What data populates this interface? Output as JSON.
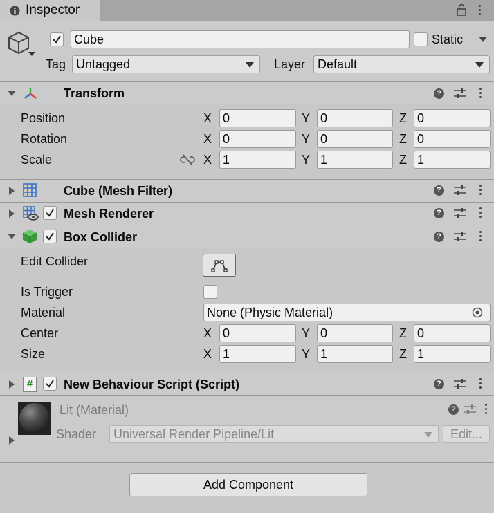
{
  "tab": {
    "title": "Inspector"
  },
  "object": {
    "active": true,
    "name": "Cube",
    "static_label": "Static",
    "tag_label": "Tag",
    "tag_value": "Untagged",
    "layer_label": "Layer",
    "layer_value": "Default"
  },
  "transform": {
    "title": "Transform",
    "rows": [
      {
        "label": "Position",
        "x": "0",
        "y": "0",
        "z": "0"
      },
      {
        "label": "Rotation",
        "x": "0",
        "y": "0",
        "z": "0"
      },
      {
        "label": "Scale",
        "x": "1",
        "y": "1",
        "z": "1"
      }
    ]
  },
  "axes": {
    "x": "X",
    "y": "Y",
    "z": "Z"
  },
  "mesh_filter": {
    "title": "Cube (Mesh Filter)"
  },
  "mesh_renderer": {
    "title": "Mesh Renderer",
    "enabled": true
  },
  "box_collider": {
    "title": "Box Collider",
    "enabled": true,
    "edit_collider_label": "Edit Collider",
    "is_trigger_label": "Is Trigger",
    "is_trigger": false,
    "material_label": "Material",
    "material_value": "None (Physic Material)",
    "center_label": "Center",
    "center": {
      "x": "0",
      "y": "0",
      "z": "0"
    },
    "size_label": "Size",
    "size": {
      "x": "1",
      "y": "1",
      "z": "1"
    }
  },
  "script": {
    "title": "New Behaviour Script (Script)",
    "enabled": true,
    "icon_glyph": "#"
  },
  "material": {
    "title": "Lit (Material)",
    "shader_label": "Shader",
    "shader_value": "Universal Render Pipeline/Lit",
    "edit_label": "Edit..."
  },
  "add_component": {
    "label": "Add Component"
  },
  "colors": {
    "panel": "#c8c8c8",
    "header": "#cbcbcb",
    "field": "#f0f0f0",
    "collider_green": "#3a9a3a",
    "grid_blue": "#3a72c4"
  }
}
